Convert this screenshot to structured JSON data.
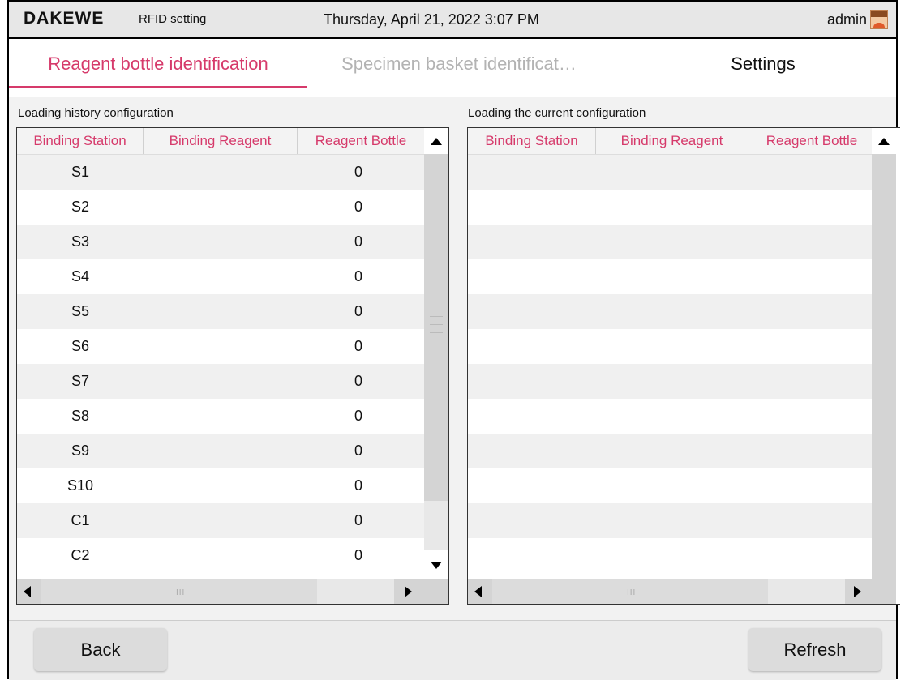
{
  "header": {
    "brand": "DAKEWE",
    "module": "RFID setting",
    "datetime": "Thursday, April 21, 2022  3:07 PM",
    "user": "admin",
    "avatar_icon": "user-avatar-icon"
  },
  "tabs": [
    {
      "label": "Reagent bottle identification",
      "state": "active"
    },
    {
      "label": "Specimen basket identificat…",
      "state": "disabled"
    },
    {
      "label": "Settings",
      "state": "normal"
    }
  ],
  "history": {
    "title": "Loading history configuration",
    "columns": [
      "Binding Station",
      "Binding Reagent",
      "Reagent Bottle"
    ],
    "rows": [
      {
        "station": "S1",
        "reagent": "",
        "bottle": "0"
      },
      {
        "station": "S2",
        "reagent": "",
        "bottle": "0"
      },
      {
        "station": "S3",
        "reagent": "",
        "bottle": "0"
      },
      {
        "station": "S4",
        "reagent": "",
        "bottle": "0"
      },
      {
        "station": "S5",
        "reagent": "",
        "bottle": "0"
      },
      {
        "station": "S6",
        "reagent": "",
        "bottle": "0"
      },
      {
        "station": "S7",
        "reagent": "",
        "bottle": "0"
      },
      {
        "station": "S8",
        "reagent": "",
        "bottle": "0"
      },
      {
        "station": "S9",
        "reagent": "",
        "bottle": "0"
      },
      {
        "station": "S10",
        "reagent": "",
        "bottle": "0"
      },
      {
        "station": "C1",
        "reagent": "",
        "bottle": "0"
      },
      {
        "station": "C2",
        "reagent": "",
        "bottle": "0"
      }
    ],
    "hscroll_grip": "III"
  },
  "current": {
    "title": "Loading the current configuration",
    "columns": [
      "Binding Station",
      "Binding Reagent",
      "Reagent Bottle"
    ],
    "rows": [],
    "hscroll_grip": "III"
  },
  "footer": {
    "back_label": "Back",
    "refresh_label": "Refresh"
  },
  "colors": {
    "accent": "#d63a6b",
    "disabled_text": "#b3b3b3",
    "header_bg": "#e7e7e7"
  }
}
